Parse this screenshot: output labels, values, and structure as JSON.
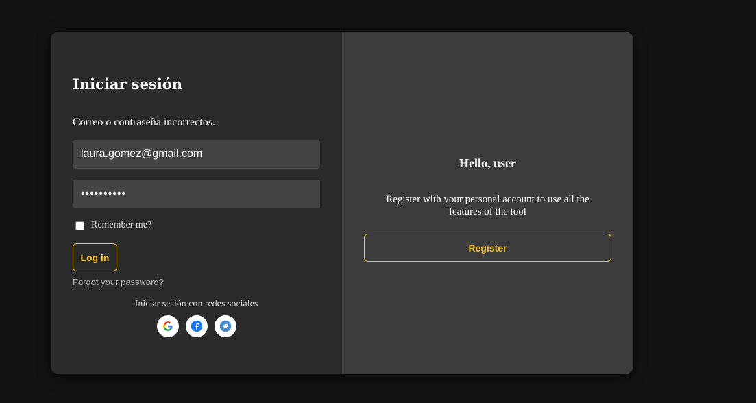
{
  "login": {
    "title": "Iniciar sesión",
    "error_message": "Correo o contraseña incorrectos.",
    "email_value": "laura.gomez@gmail.com",
    "password_value": "••••••••••",
    "remember_label": "Remember me?",
    "login_label": "Log in",
    "forgot_label": "Forgot your password?",
    "social_label": "Iniciar sesión con redes sociales",
    "social_icons": [
      "google-icon",
      "facebook-icon",
      "twitter-icon"
    ]
  },
  "register": {
    "heading": "Hello, user",
    "text": "Register with your personal account to use all the features of the tool",
    "button_label": "Register"
  },
  "colors": {
    "page_bg": "#121212",
    "left_panel": "#2b2b2b",
    "right_panel": "#3c3c3c",
    "input_bg": "#444444",
    "accent": "#f2c230"
  }
}
